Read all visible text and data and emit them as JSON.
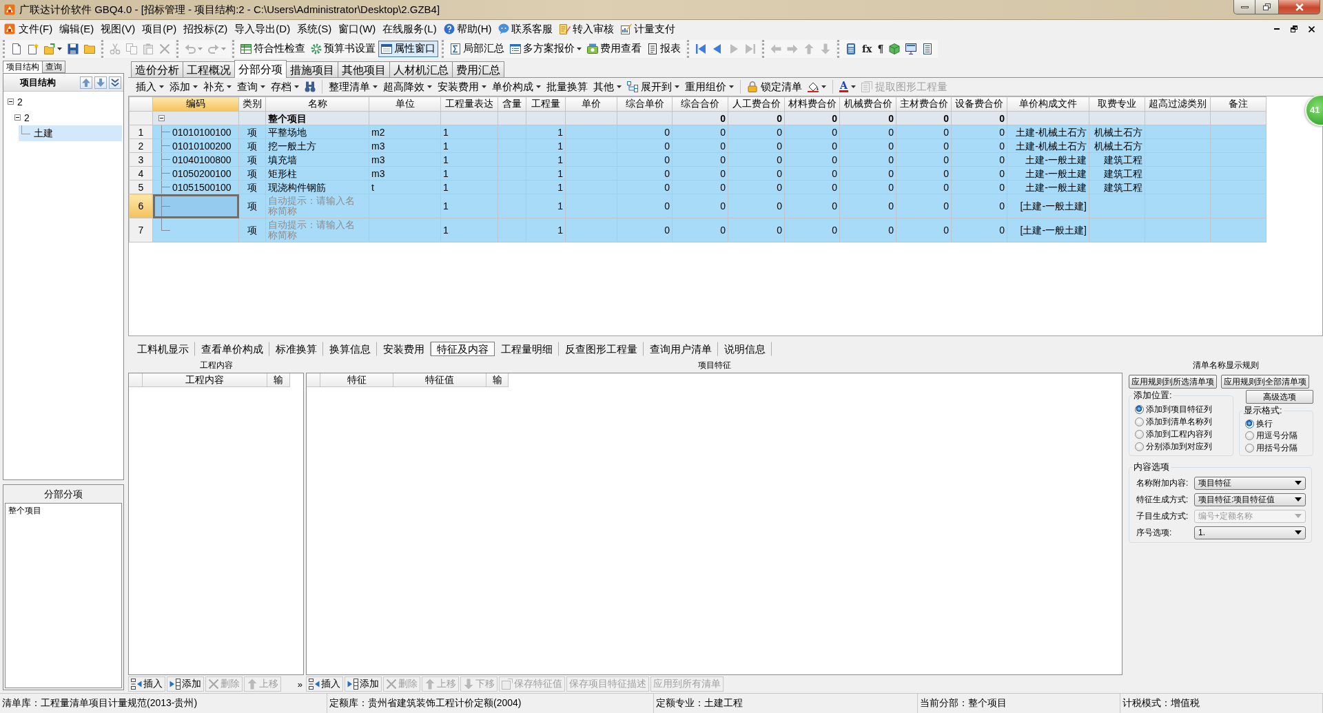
{
  "window": {
    "title": "广联达计价软件 GBQ4.0 - [招标管理 - 项目结构:2 - C:\\Users\\Administrator\\Desktop\\2.GZB4]"
  },
  "menu": [
    {
      "label": "文件(F)",
      "kind": "plain"
    },
    {
      "label": "编辑(E)",
      "kind": "plain"
    },
    {
      "label": "视图(V)",
      "kind": "plain"
    },
    {
      "label": "项目(P)",
      "kind": "plain"
    },
    {
      "label": "招投标(Z)",
      "kind": "plain"
    },
    {
      "label": "导入导出(D)",
      "kind": "plain"
    },
    {
      "label": "系统(S)",
      "kind": "plain"
    },
    {
      "label": "窗口(W)",
      "kind": "plain"
    },
    {
      "label": "在线服务(L)",
      "kind": "plain"
    },
    {
      "label": "帮助(H)",
      "kind": "icon"
    },
    {
      "label": "联系客服",
      "kind": "icon"
    },
    {
      "label": "转入审核",
      "kind": "icon"
    },
    {
      "label": "计量支付",
      "kind": "icon"
    }
  ],
  "toolbar": {
    "groups": [
      {
        "items": [
          {
            "kind": "icon",
            "disabled": false,
            "on": false
          },
          {
            "kind": "icon",
            "disabled": false,
            "on": false
          },
          {
            "kind": "icon_menu",
            "disabled": false,
            "on": false
          },
          {
            "kind": "icon",
            "disabled": false,
            "on": false
          },
          {
            "kind": "icon",
            "disabled": false,
            "on": false
          }
        ]
      },
      {
        "items": [
          {
            "kind": "icon",
            "disabled": true,
            "on": false
          },
          {
            "kind": "icon",
            "disabled": true,
            "on": false
          },
          {
            "kind": "icon",
            "disabled": true,
            "on": false
          },
          {
            "kind": "icon",
            "disabled": true,
            "on": false
          }
        ]
      },
      {
        "items": [
          {
            "kind": "icon_menu",
            "disabled": true,
            "on": false
          },
          {
            "kind": "icon_menu",
            "disabled": true,
            "on": false
          }
        ]
      },
      {
        "items": [
          {
            "kind": "icon_label",
            "label": "符合性检查",
            "disabled": false,
            "on": false
          },
          {
            "kind": "icon_label",
            "label": "预算书设置",
            "disabled": false,
            "on": false
          },
          {
            "kind": "icon_label",
            "label": "属性窗口",
            "disabled": false,
            "on": true
          }
        ]
      },
      {
        "items": [
          {
            "kind": "icon_label",
            "label": "局部汇总",
            "disabled": false,
            "on": false
          },
          {
            "kind": "icon_label_menu",
            "label": "多方案报价",
            "disabled": false,
            "on": false
          },
          {
            "kind": "icon_label",
            "label": "费用查看",
            "disabled": false,
            "on": false
          },
          {
            "kind": "icon_label",
            "label": "报表",
            "disabled": false,
            "on": false
          }
        ]
      },
      {
        "items": [
          {
            "kind": "icon",
            "disabled": false,
            "on": false
          },
          {
            "kind": "icon",
            "disabled": false,
            "on": false
          },
          {
            "kind": "icon",
            "disabled": true,
            "on": false
          },
          {
            "kind": "icon",
            "disabled": true,
            "on": false
          }
        ]
      },
      {
        "items": [
          {
            "kind": "icon",
            "disabled": true,
            "on": false
          },
          {
            "kind": "icon",
            "disabled": true,
            "on": false
          },
          {
            "kind": "icon",
            "disabled": true,
            "on": false
          },
          {
            "kind": "icon",
            "disabled": true,
            "on": false
          }
        ]
      },
      {
        "items": [
          {
            "kind": "icon",
            "disabled": false,
            "on": false
          },
          {
            "kind": "glyph",
            "glyph": "fx",
            "disabled": false,
            "on": false
          },
          {
            "kind": "glyph",
            "glyph": "¶",
            "disabled": false,
            "on": false
          },
          {
            "kind": "icon",
            "disabled": false,
            "on": false
          },
          {
            "kind": "icon",
            "disabled": false,
            "on": false
          },
          {
            "kind": "icon",
            "disabled": false,
            "on": false
          }
        ]
      }
    ]
  },
  "left_panel": {
    "tabs": [
      {
        "label": "项目结构",
        "selected": true
      },
      {
        "label": "查询",
        "selected": false
      }
    ],
    "title": "项目结构",
    "tree": [
      {
        "label": "2",
        "expanded": true,
        "selected": false,
        "children": [
          {
            "label": "2",
            "expanded": true,
            "selected": false,
            "children": [
              {
                "label": "土建",
                "selected": true
              }
            ]
          }
        ]
      }
    ],
    "section_title": "分部分项",
    "section_items": [
      "整个项目"
    ]
  },
  "tabs": [
    {
      "label": "造价分析",
      "selected": false
    },
    {
      "label": "工程概况",
      "selected": false
    },
    {
      "label": "分部分项",
      "selected": true
    },
    {
      "label": "措施项目",
      "selected": false
    },
    {
      "label": "其他项目",
      "selected": false
    },
    {
      "label": "人材机汇总",
      "selected": false
    },
    {
      "label": "费用汇总",
      "selected": false
    }
  ],
  "list_toolbar": {
    "groups": [
      {
        "items": [
          {
            "kind": "label_menu",
            "label": "插入",
            "disabled": false
          },
          {
            "kind": "label_menu",
            "label": "添加",
            "disabled": false
          },
          {
            "kind": "label_menu",
            "label": "补充",
            "disabled": false
          },
          {
            "kind": "label_menu",
            "label": "查询",
            "disabled": false
          },
          {
            "kind": "label_menu",
            "label": "存档",
            "disabled": false
          },
          {
            "kind": "icon",
            "disabled": false
          }
        ]
      },
      {
        "items": [
          {
            "kind": "label_menu",
            "label": "整理清单",
            "disabled": false
          },
          {
            "kind": "label_menu",
            "label": "超高降效",
            "disabled": false
          },
          {
            "kind": "label_menu",
            "label": "安装费用",
            "disabled": false
          },
          {
            "kind": "label_menu",
            "label": "单价构成",
            "disabled": false
          },
          {
            "kind": "label",
            "label": "批量换算",
            "disabled": false
          },
          {
            "kind": "label_menu",
            "label": "其他",
            "disabled": false
          },
          {
            "kind": "icon_label_menu",
            "label": "展开到",
            "disabled": false
          },
          {
            "kind": "label_menu",
            "label": "重用组价",
            "disabled": false
          }
        ]
      },
      {
        "items": [
          {
            "kind": "icon_label",
            "label": "锁定清单",
            "disabled": false
          },
          {
            "kind": "icon_menu",
            "disabled": false
          }
        ]
      },
      {
        "items": [
          {
            "kind": "glyph_color_menu",
            "glyph": "A",
            "disabled": false
          },
          {
            "kind": "icon_label",
            "label": "提取图形工程量",
            "disabled": true
          }
        ]
      }
    ]
  },
  "table": {
    "columns": [
      {
        "label": "编码",
        "selected": true
      },
      {
        "label": "类别",
        "selected": false
      },
      {
        "label": "名称",
        "selected": false
      },
      {
        "label": "单位",
        "selected": false
      },
      {
        "label": "工程量表达",
        "selected": false
      },
      {
        "label": "含量",
        "selected": false
      },
      {
        "label": "工程量",
        "selected": false
      },
      {
        "label": "单价",
        "selected": false
      },
      {
        "label": "综合单价",
        "selected": false
      },
      {
        "label": "综合合价",
        "selected": false
      },
      {
        "label": "人工费合价",
        "selected": false
      },
      {
        "label": "材料费合价",
        "selected": false
      },
      {
        "label": "机械费合价",
        "selected": false
      },
      {
        "label": "主材费合价",
        "selected": false
      },
      {
        "label": "设备费合价",
        "selected": false
      },
      {
        "label": "单价构成文件",
        "selected": false
      },
      {
        "label": "取费专业",
        "selected": false
      },
      {
        "label": "超高过滤类别",
        "selected": false
      },
      {
        "label": "备注",
        "selected": false
      }
    ],
    "rows": [
      {
        "kind": "section",
        "selected": false,
        "expanded": true,
        "cells": [
          null,
          null,
          "整个项目",
          null,
          null,
          null,
          null,
          null,
          null,
          "0",
          "0",
          "0",
          "0",
          "0",
          "0",
          null,
          null,
          null,
          null
        ]
      },
      {
        "kind": "item",
        "number": "1",
        "selected": false,
        "cells": [
          "01010100100",
          "项",
          "平整场地",
          "m2",
          "1",
          null,
          "1",
          null,
          "0",
          "0",
          "0",
          "0",
          "0",
          "0",
          "0",
          "土建-机械土石方",
          "机械土石方",
          null,
          null
        ]
      },
      {
        "kind": "item",
        "number": "2",
        "selected": false,
        "cells": [
          "01010100200",
          "项",
          "挖一般土方",
          "m3",
          "1",
          null,
          "1",
          null,
          "0",
          "0",
          "0",
          "0",
          "0",
          "0",
          "0",
          "土建-机械土石方",
          "机械土石方",
          null,
          null
        ]
      },
      {
        "kind": "item",
        "number": "3",
        "selected": false,
        "cells": [
          "01040100800",
          "项",
          "填充墙",
          "m3",
          "1",
          null,
          "1",
          null,
          "0",
          "0",
          "0",
          "0",
          "0",
          "0",
          "0",
          "土建-一般土建",
          "建筑工程",
          null,
          null
        ]
      },
      {
        "kind": "item",
        "number": "4",
        "selected": false,
        "cells": [
          "01050200100",
          "项",
          "矩形柱",
          "m3",
          "1",
          null,
          "1",
          null,
          "0",
          "0",
          "0",
          "0",
          "0",
          "0",
          "0",
          "土建-一般土建",
          "建筑工程",
          null,
          null
        ]
      },
      {
        "kind": "item",
        "number": "5",
        "selected": false,
        "cells": [
          "01051500100",
          "项",
          "现浇构件钢筋",
          "t",
          "1",
          null,
          "1",
          null,
          "0",
          "0",
          "0",
          "0",
          "0",
          "0",
          "0",
          "土建-一般土建",
          "建筑工程",
          null,
          null
        ]
      },
      {
        "kind": "draft",
        "number": "6",
        "selected": true,
        "cells": [
          null,
          "项",
          "自动提示：请输入名称简称",
          null,
          "1",
          null,
          "1",
          null,
          "0",
          "0",
          "0",
          "0",
          "0",
          "0",
          "0",
          "[土建-一般土建]",
          null,
          null,
          null
        ]
      },
      {
        "kind": "draft",
        "number": "7",
        "selected": false,
        "cells": [
          null,
          "项",
          "自动提示：请输入名称简称",
          null,
          "1",
          null,
          "1",
          null,
          "0",
          "0",
          "0",
          "0",
          "0",
          "0",
          "0",
          "[土建-一般土建]",
          null,
          null,
          null
        ]
      }
    ]
  },
  "floating_badge": "41",
  "detail_tabs": [
    {
      "label": "工料机显示",
      "selected": false
    },
    {
      "label": "查看单价构成",
      "selected": false
    },
    {
      "label": "标准换算",
      "selected": false
    },
    {
      "label": "换算信息",
      "selected": false
    },
    {
      "label": "安装费用",
      "selected": false
    },
    {
      "label": "特征及内容",
      "selected": true
    },
    {
      "label": "工程量明细",
      "selected": false
    },
    {
      "label": "反查图形工程量",
      "selected": false
    },
    {
      "label": "查询用户清单",
      "selected": false
    },
    {
      "label": "说明信息",
      "selected": false
    }
  ],
  "content_panel": {
    "title": "工程内容",
    "columns": [
      "工程内容",
      "输"
    ],
    "buttons": [
      {
        "label": "插入",
        "disabled": false
      },
      {
        "label": "添加",
        "disabled": false
      },
      {
        "label": "删除",
        "disabled": true
      },
      {
        "label": "上移",
        "disabled": true
      }
    ],
    "more": "»"
  },
  "feature_panel": {
    "title": "项目特征",
    "columns": [
      "特征",
      "特征值",
      "输"
    ],
    "buttons": [
      {
        "label": "插入",
        "disabled": false
      },
      {
        "label": "添加",
        "disabled": false
      },
      {
        "label": "删除",
        "disabled": true
      },
      {
        "label": "上移",
        "disabled": true
      },
      {
        "label": "下移",
        "disabled": true
      },
      {
        "label": "保存特征值",
        "disabled": true
      },
      {
        "label": "保存项目特征描述",
        "disabled": true
      },
      {
        "label": "应用到所有清单",
        "disabled": true
      }
    ]
  },
  "rules_panel": {
    "title": "清单名称显示规则",
    "apply_buttons": [
      "应用规则到所选清单项",
      "应用规则到全部清单项"
    ],
    "advanced_button": "高级选项",
    "add_position": {
      "title": "添加位置:",
      "options": [
        {
          "label": "添加到项目特征列",
          "selected": true
        },
        {
          "label": "添加到清单名称列",
          "selected": false
        },
        {
          "label": "添加到工程内容列",
          "selected": false
        },
        {
          "label": "分别添加到对应列",
          "selected": false
        }
      ]
    },
    "display_format": {
      "title": "显示格式:",
      "options": [
        {
          "label": "换行",
          "selected": true
        },
        {
          "label": "用逗号分隔",
          "selected": false
        },
        {
          "label": "用括号分隔",
          "selected": false
        }
      ]
    },
    "content_options": {
      "title": "内容选项",
      "fields": [
        {
          "label": "名称附加内容:",
          "value": "项目特征",
          "disabled": false
        },
        {
          "label": "特征生成方式:",
          "value": "项目特征:项目特征值",
          "disabled": false
        },
        {
          "label": "子目生成方式:",
          "value": "编号+定额名称",
          "disabled": true
        },
        {
          "label": "序号选项:",
          "value": "1.",
          "disabled": false
        }
      ]
    }
  },
  "status_bar": [
    "清单库：工程量清单项目计量规范(2013-贵州)",
    "定额库：贵州省建筑装饰工程计价定额(2004)",
    "定额专业：土建工程",
    "当前分部：整个项目",
    "计税模式：增值税"
  ]
}
